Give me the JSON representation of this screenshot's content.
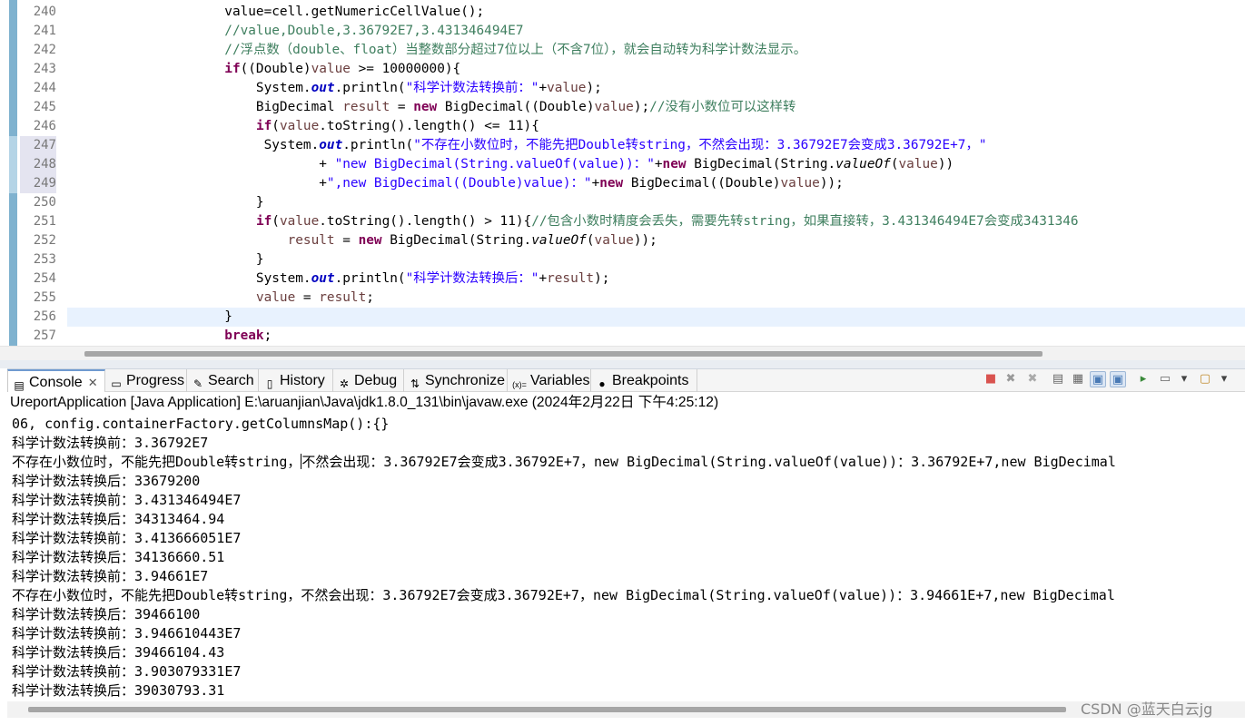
{
  "editor": {
    "line_numbers": [
      "240",
      "241",
      "242",
      "243",
      "244",
      "245",
      "246",
      "247",
      "248",
      "249",
      "250",
      "251",
      "252",
      "253",
      "254",
      "255",
      "256",
      "257"
    ],
    "lines": [
      [
        {
          "t": "                    value=cell.getNumericCellValue();",
          "c": ""
        }
      ],
      [
        {
          "t": "                    //value,Double,3.36792E7,3.431346494E7",
          "c": "cm"
        }
      ],
      [
        {
          "t": "                    //浮点数（double、float）当整数部分超过7位以上（不含7位），就会自动转为科学计数法显示。",
          "c": "cm"
        }
      ],
      [
        {
          "t": "                    ",
          "c": ""
        },
        {
          "t": "if",
          "c": "kw"
        },
        {
          "t": "((Double)",
          "c": ""
        },
        {
          "t": "value",
          "c": "var"
        },
        {
          "t": " >= 10000000){",
          "c": ""
        }
      ],
      [
        {
          "t": "                        System.",
          "c": ""
        },
        {
          "t": "out",
          "c": "fld"
        },
        {
          "t": ".println(",
          "c": ""
        },
        {
          "t": "\"科学计数法转换前：\"",
          "c": "st"
        },
        {
          "t": "+",
          "c": ""
        },
        {
          "t": "value",
          "c": "var"
        },
        {
          "t": ");",
          "c": ""
        }
      ],
      [
        {
          "t": "                        BigDecimal ",
          "c": ""
        },
        {
          "t": "result",
          "c": "var"
        },
        {
          "t": " = ",
          "c": ""
        },
        {
          "t": "new",
          "c": "kw"
        },
        {
          "t": " BigDecimal((Double)",
          "c": ""
        },
        {
          "t": "value",
          "c": "var"
        },
        {
          "t": ");",
          "c": ""
        },
        {
          "t": "//没有小数位可以这样转",
          "c": "cm"
        }
      ],
      [
        {
          "t": "                        ",
          "c": ""
        },
        {
          "t": "if",
          "c": "kw"
        },
        {
          "t": "(",
          "c": ""
        },
        {
          "t": "value",
          "c": "var"
        },
        {
          "t": ".toString().length() <= 11){",
          "c": ""
        }
      ],
      [
        {
          "t": "                         System.",
          "c": ""
        },
        {
          "t": "out",
          "c": "fld"
        },
        {
          "t": ".println(",
          "c": ""
        },
        {
          "t": "\"不存在小数位时，不能先把Double转string，不然会出现：3.36792E7会变成3.36792E+7，\"",
          "c": "st"
        }
      ],
      [
        {
          "t": "                                + ",
          "c": ""
        },
        {
          "t": "\"new BigDecimal(String.valueOf(value))：\"",
          "c": "st"
        },
        {
          "t": "+",
          "c": ""
        },
        {
          "t": "new",
          "c": "kw"
        },
        {
          "t": " BigDecimal(String.",
          "c": ""
        },
        {
          "t": "valueOf",
          "c": "it"
        },
        {
          "t": "(",
          "c": ""
        },
        {
          "t": "value",
          "c": "var"
        },
        {
          "t": "))",
          "c": ""
        }
      ],
      [
        {
          "t": "                                +",
          "c": ""
        },
        {
          "t": "\",new BigDecimal((Double)value)：\"",
          "c": "st"
        },
        {
          "t": "+",
          "c": ""
        },
        {
          "t": "new",
          "c": "kw"
        },
        {
          "t": " BigDecimal((Double)",
          "c": ""
        },
        {
          "t": "value",
          "c": "var"
        },
        {
          "t": "));",
          "c": ""
        }
      ],
      [
        {
          "t": "                        }",
          "c": ""
        }
      ],
      [
        {
          "t": "                        ",
          "c": ""
        },
        {
          "t": "if",
          "c": "kw"
        },
        {
          "t": "(",
          "c": ""
        },
        {
          "t": "value",
          "c": "var"
        },
        {
          "t": ".toString().length() > 11){",
          "c": ""
        },
        {
          "t": "//包含小数时精度会丢失，需要先转string，如果直接转，3.431346494E7会变成3431346",
          "c": "cm"
        }
      ],
      [
        {
          "t": "                            ",
          "c": ""
        },
        {
          "t": "result",
          "c": "var"
        },
        {
          "t": " = ",
          "c": ""
        },
        {
          "t": "new",
          "c": "kw"
        },
        {
          "t": " BigDecimal(String.",
          "c": ""
        },
        {
          "t": "valueOf",
          "c": "it"
        },
        {
          "t": "(",
          "c": ""
        },
        {
          "t": "value",
          "c": "var"
        },
        {
          "t": "));",
          "c": ""
        }
      ],
      [
        {
          "t": "                        }",
          "c": ""
        }
      ],
      [
        {
          "t": "                        System.",
          "c": ""
        },
        {
          "t": "out",
          "c": "fld"
        },
        {
          "t": ".println(",
          "c": ""
        },
        {
          "t": "\"科学计数法转换后：\"",
          "c": "st"
        },
        {
          "t": "+",
          "c": ""
        },
        {
          "t": "result",
          "c": "var"
        },
        {
          "t": ");",
          "c": ""
        }
      ],
      [
        {
          "t": "                        ",
          "c": ""
        },
        {
          "t": "value",
          "c": "var"
        },
        {
          "t": " = ",
          "c": ""
        },
        {
          "t": "result",
          "c": "var"
        },
        {
          "t": ";",
          "c": ""
        }
      ],
      [
        {
          "t": "                    }",
          "c": ""
        }
      ],
      [
        {
          "t": "                    ",
          "c": ""
        },
        {
          "t": "break",
          "c": "kw"
        },
        {
          "t": ";",
          "c": ""
        }
      ]
    ]
  },
  "tabs": [
    {
      "label": "Console",
      "icon": "console-icon",
      "glyph": "▤",
      "active": true,
      "closable": true
    },
    {
      "label": "Progress",
      "icon": "progress-icon",
      "glyph": "▭",
      "active": false
    },
    {
      "label": "Search",
      "icon": "search-icon",
      "glyph": "✎",
      "active": false
    },
    {
      "label": "History",
      "icon": "history-icon",
      "glyph": "▯",
      "active": false
    },
    {
      "label": "Debug",
      "icon": "debug-icon",
      "glyph": "✲",
      "active": false
    },
    {
      "label": "Synchronize",
      "icon": "synchronize-icon",
      "glyph": "⇅",
      "active": false
    },
    {
      "label": "Variables",
      "icon": "variables-icon",
      "glyph": "(x)=",
      "active": false
    },
    {
      "label": "Breakpoints",
      "icon": "breakpoints-icon",
      "glyph": "●",
      "active": false
    }
  ],
  "toolbar": [
    {
      "name": "terminate-icon",
      "glyph": "■",
      "color": "#d9534f"
    },
    {
      "name": "remove-launch-icon",
      "glyph": "✖",
      "color": "#999999"
    },
    {
      "name": "remove-all-terminated-icon",
      "glyph": "✖",
      "color": "#aaaaaa"
    },
    {
      "name": "clear-console-icon",
      "glyph": "▤",
      "color": "#666666"
    },
    {
      "name": "scroll-lock-icon",
      "glyph": "▦",
      "color": "#666666"
    },
    {
      "name": "word-wrap-icon",
      "glyph": "▣",
      "color": "#4a7ab5",
      "on": true
    },
    {
      "name": "show-console-on-output-icon",
      "glyph": "▣",
      "color": "#4a7ab5",
      "on": true
    },
    {
      "name": "pin-console-icon",
      "glyph": "▸",
      "color": "#3a8a3a"
    },
    {
      "name": "display-selected-console-icon",
      "glyph": "▭",
      "color": "#666666"
    },
    {
      "name": "display-selected-console-dropdown-icon",
      "glyph": "▾",
      "color": "#444444"
    },
    {
      "name": "open-console-icon",
      "glyph": "▢",
      "color": "#c08a2a"
    },
    {
      "name": "open-console-dropdown-icon",
      "glyph": "▾",
      "color": "#444444"
    }
  ],
  "console": {
    "header": "UreportApplication [Java Application] E:\\aruanjian\\Java\\jdk1.8.0_131\\bin\\javaw.exe (2024年2月22日 下午4:25:12)",
    "lines": [
      "06, config.containerFactory.getColumnsMap():{}",
      "科学计数法转换前：3.36792E7",
      "不存在小数位时，不能先把Double转string，不然会出现：3.36792E7会变成3.36792E+7，new BigDecimal(String.valueOf(value))：3.36792E+7,new BigDecimal",
      "科学计数法转换后：33679200",
      "科学计数法转换前：3.431346494E7",
      "科学计数法转换后：34313464.94",
      "科学计数法转换前：3.413666051E7",
      "科学计数法转换后：34136660.51",
      "科学计数法转换前：3.94661E7",
      "不存在小数位时，不能先把Double转string，不然会出现：3.36792E7会变成3.36792E+7，new BigDecimal(String.valueOf(value))：3.94661E+7,new BigDecimal",
      "科学计数法转换后：39466100",
      "科学计数法转换前：3.946610443E7",
      "科学计数法转换后：39466104.43",
      "科学计数法转换前：3.903079331E7",
      "科学计数法转换后：39030793.31"
    ]
  },
  "watermark": "CSDN @蓝天白云jg"
}
